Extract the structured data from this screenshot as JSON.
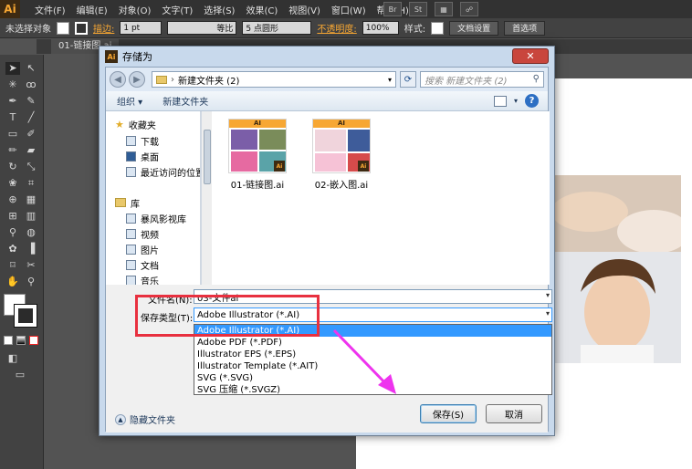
{
  "app": {
    "logo": "Ai",
    "menu": [
      "文件(F)",
      "编辑(E)",
      "对象(O)",
      "文字(T)",
      "选择(S)",
      "效果(C)",
      "视图(V)",
      "窗口(W)",
      "帮助(H)"
    ],
    "menubar_br": "Br",
    "menubar_st": "St"
  },
  "controlbar": {
    "no_selection": "未选择对象",
    "stroke_label": "描边:",
    "stroke_value": "1 pt",
    "line_label": "等比",
    "point_label": "5 点圆形",
    "opacity_label": "不透明度:",
    "opacity_value": "100%",
    "style_label": "样式:",
    "doc_setup": "文档设置",
    "preferences": "首选项"
  },
  "doc_tab": {
    "label": "01-链接图.ai"
  },
  "dialog": {
    "title": "存储为",
    "close": "✕",
    "breadcrumb": "新建文件夹 (2)",
    "search_placeholder": "搜索 新建文件夹 (2)",
    "organize": "组织 ▾",
    "new_folder": "新建文件夹",
    "nav": {
      "favorites": "收藏夹",
      "downloads": "下载",
      "desktop": "桌面",
      "recent": "最近访问的位置",
      "library": "库",
      "storm": "暴风影视库",
      "videos": "视频",
      "pictures": "图片",
      "documents": "文档",
      "music": "音乐"
    },
    "files": [
      {
        "name": "01-链接图.ai",
        "thumb_tag": "AI",
        "badge": "Ai"
      },
      {
        "name": "02-嵌入图.ai",
        "thumb_tag": "AI",
        "badge": "Ai"
      }
    ],
    "filename_label": "文件名(N):",
    "filename_value": "03-文件ai",
    "type_label": "保存类型(T):",
    "type_value": "Adobe Illustrator (*.AI)",
    "type_options": [
      "Adobe Illustrator (*.AI)",
      "Adobe PDF (*.PDF)",
      "Illustrator EPS (*.EPS)",
      "Illustrator Template (*.AIT)",
      "SVG (*.SVG)",
      "SVG 压缩 (*.SVGZ)"
    ],
    "hide_folders": "隐藏文件夹",
    "save": "保存(S)",
    "cancel": "取消"
  },
  "colors": {
    "accent": "#f7a733",
    "highlight": "#3399ff",
    "annotation_red": "#e8303f",
    "annotation_magenta": "#ee33ee"
  }
}
